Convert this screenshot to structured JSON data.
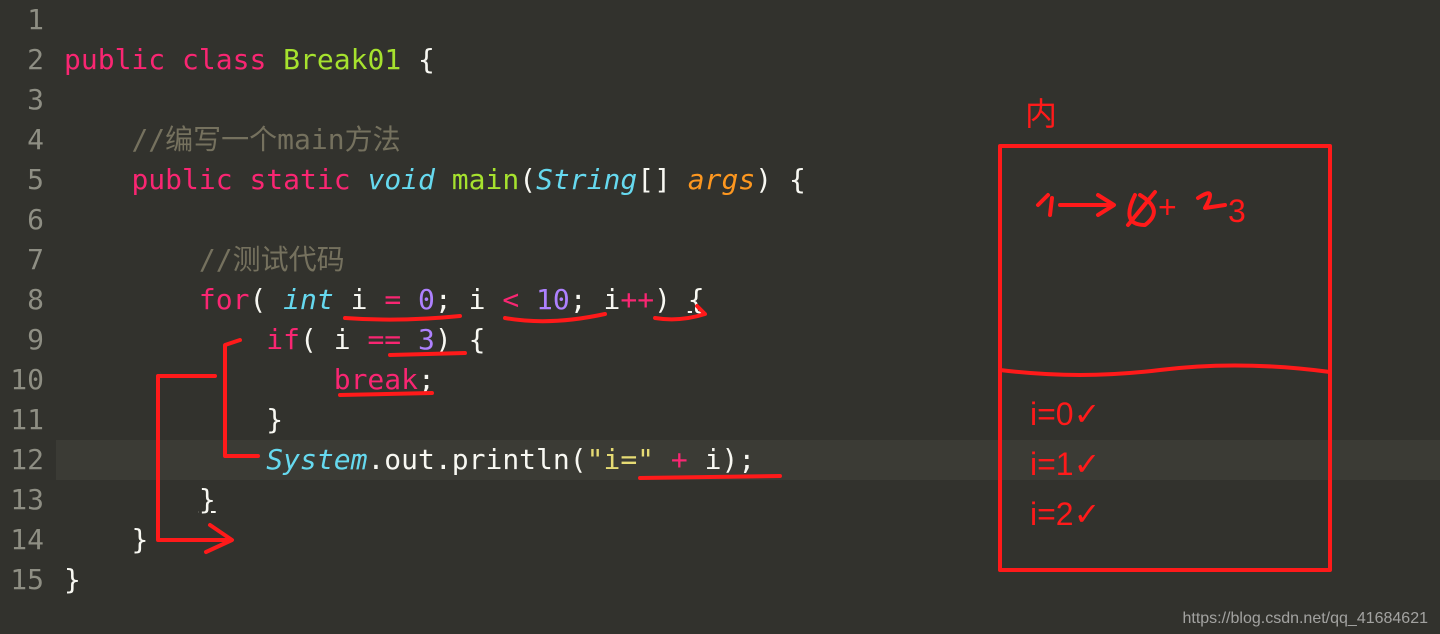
{
  "lines": {
    "1": "1",
    "2": "2",
    "3": "3",
    "4": "4",
    "5": "5",
    "6": "6",
    "7": "7",
    "8": "8",
    "9": "9",
    "10": "10",
    "11": "11",
    "12": "12",
    "13": "13",
    "14": "14",
    "15": "15"
  },
  "code": {
    "l2": {
      "kw1": "public",
      "kw2": "class",
      "cls": "Break01",
      "brace": " {"
    },
    "l4": {
      "comment": "//编写一个main方法"
    },
    "l5": {
      "kw1": "public",
      "kw2": "static",
      "ret": "void",
      "fn": "main",
      "paren_open": "(",
      "type": "String",
      "brackets": "[] ",
      "arg": "args",
      "paren_close": ")",
      "brace": " {"
    },
    "l7": {
      "comment": "//测试代码"
    },
    "l8": {
      "for": "for",
      "p1": "( ",
      "int": "int",
      "var": " i ",
      "eq": "=",
      "sp1": " ",
      "zero": "0",
      "semi1": "; i ",
      "lt": "<",
      "sp2": " ",
      "ten": "10",
      "semi2": "; i",
      "pp": "++",
      "p2": ") ",
      "brace": "{"
    },
    "l9": {
      "if": "if",
      "p1": "( i ",
      "eq": "==",
      "sp": " ",
      "three": "3",
      "p2": ") ",
      "brace": "{"
    },
    "l10": {
      "break": "break",
      "semi": ";"
    },
    "l11": {
      "brace": "}"
    },
    "l12": {
      "sys": "System",
      "dot1": ".out.println(",
      "str": "\"i=\"",
      "sp": " ",
      "plus": "+",
      "var": " i",
      "end": ");"
    },
    "l13": {
      "brace": "}"
    },
    "l14": {
      "brace": "}"
    },
    "l15": {
      "brace": "}"
    }
  },
  "annotations": {
    "label_top": "内",
    "box_line1": "i→0+23",
    "box_line2": "i=0✓",
    "box_line3": "i=1✓",
    "box_line4": "i=2✓"
  },
  "watermark": "https://blog.csdn.net/qq_41684621"
}
